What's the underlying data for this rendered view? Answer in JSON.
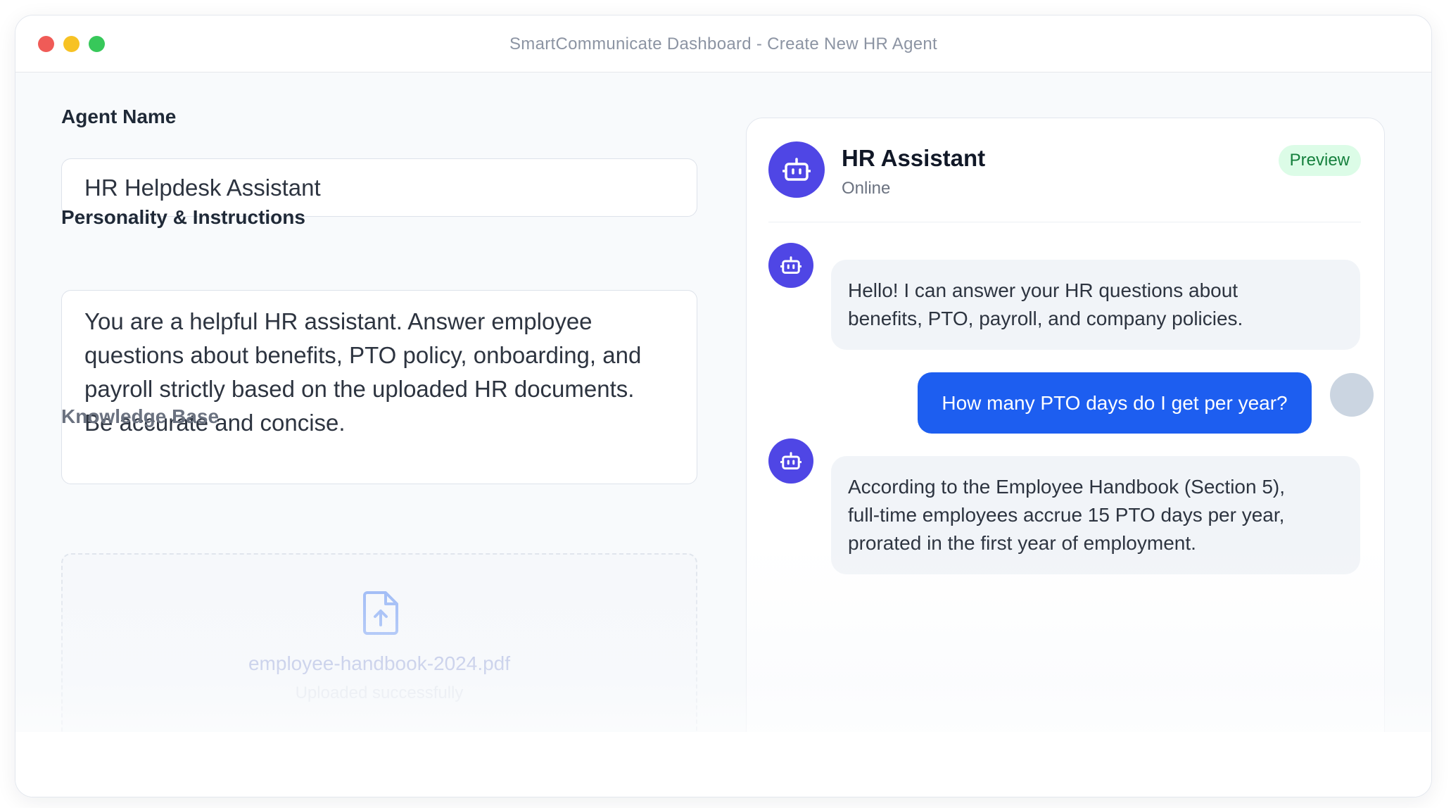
{
  "window": {
    "title": "SmartCommunicate Dashboard - Create New HR Agent"
  },
  "form": {
    "agent_name_label": "Agent Name",
    "agent_name_value": "HR Helpdesk Assistant",
    "instructions_label": "Personality & Instructions",
    "instructions_lines": [
      "You are a helpful HR assistant. Answer employee",
      "questions about benefits, PTO policy, onboarding, and",
      "payroll strictly based on the uploaded HR documents.",
      "Be accurate and concise."
    ],
    "knowledge_base_label": "Knowledge Base",
    "file_name": "employee-handbook-2024.pdf",
    "file_status": "Uploaded successfully"
  },
  "chat": {
    "agent_title": "HR Assistant",
    "agent_status": "Online",
    "badge": "Preview",
    "messages": [
      {
        "role": "bot",
        "lines": [
          "Hello! I can answer your HR questions about",
          "benefits, PTO, payroll, and company policies."
        ]
      },
      {
        "role": "user",
        "text": "How many PTO days do I get per year?"
      },
      {
        "role": "bot",
        "lines": [
          "According to the Employee Handbook (Section 5),",
          "full-time employees accrue 15 PTO days per year,",
          "prorated in the first year of employment."
        ]
      }
    ]
  },
  "icons": {
    "bot_avatar": "robot-icon",
    "upload": "file-upload-icon",
    "user_avatar": "user-avatar"
  },
  "colors": {
    "accent": "#4f46e5",
    "user_bubble": "#1d5ef0",
    "badge_bg": "#dcfce7",
    "badge_text": "#15803d"
  }
}
